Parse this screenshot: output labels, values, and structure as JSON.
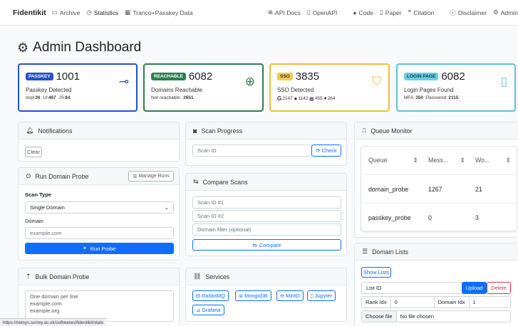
{
  "nav": {
    "brand": "Fidentikit",
    "items": [
      {
        "icon": "archive-icon",
        "glyph": "▭",
        "label": "Archive"
      },
      {
        "icon": "speedometer-icon",
        "glyph": "◷",
        "label": "Statistics"
      },
      {
        "icon": "dataset-icon",
        "glyph": "▦",
        "label": "Tranco+Passkey Data"
      },
      {
        "icon": "globe-icon",
        "glyph": "⊕",
        "label": "API Docs"
      },
      {
        "icon": "file-icon",
        "glyph": "▯",
        "label": "OpenAPI"
      },
      {
        "icon": "github-icon",
        "glyph": "●",
        "label": "Code"
      },
      {
        "icon": "paper-icon",
        "glyph": "▯",
        "label": "Paper"
      },
      {
        "icon": "quote-icon",
        "glyph": "❝",
        "label": "Citation"
      },
      {
        "icon": "info-icon",
        "glyph": "ⓘ",
        "label": "Disclaimer"
      },
      {
        "icon": "gear-icon",
        "glyph": "⚙",
        "label": "Admin"
      }
    ]
  },
  "page": {
    "title": "Admin Dashboard"
  },
  "stats": {
    "passkey": {
      "badge": "PASSKEY",
      "value": "1001",
      "sub": "Passkey Detected",
      "impl_label": "Impl",
      "impl": "26",
      "ui_label": "UI",
      "ui": "467",
      "js_label": "JS",
      "js": "84",
      "color": "#2451c7",
      "badge_color": "#2451c7"
    },
    "reachable": {
      "badge": "REACHABLE",
      "value": "6082",
      "sub": "Domains Reachable",
      "not_label": "Not reachable:",
      "not_value": "2651",
      "color": "#2e7d4f",
      "badge_color": "#2e7d4f"
    },
    "sso": {
      "badge": "SSO",
      "value": "3835",
      "sub": "SSO Detected",
      "google": "2147",
      "apple": "1142",
      "microsoft": "455",
      "github": "264",
      "color": "#f0bf3a",
      "badge_color": "#f2c94c"
    },
    "login": {
      "badge": "LOGIN PAGE",
      "value": "6082",
      "sub": "Login Pages Found",
      "mfa_label": "MFA:",
      "mfa": "350",
      "pw_label": "Password:",
      "pw": "2115",
      "color": "#5bc3df",
      "badge_color": "#66cfe6"
    }
  },
  "notifications": {
    "title": "Notifications",
    "clear": "Clear"
  },
  "scan_progress": {
    "title": "Scan Progress",
    "placeholder": "Scan ID",
    "check": "Check"
  },
  "queue": {
    "title": "Queue Monitor",
    "headers": [
      "Queue",
      "Mess...",
      "Wo..."
    ],
    "rows": [
      {
        "name": "domain_probe",
        "messages": "1267",
        "workers": "21"
      },
      {
        "name": "passkey_probe",
        "messages": "0",
        "workers": "3"
      }
    ]
  },
  "run_probe": {
    "title": "Run Domain Probe",
    "manage": "Manage Runs",
    "scan_type_label": "Scan Type",
    "scan_type": "Single Domain",
    "domain_label": "Domain",
    "domain_placeholder": "example.com",
    "run": "Run Probe"
  },
  "compare": {
    "title": "Compare Scans",
    "id1": "Scan ID #1",
    "id2": "Scan ID #2",
    "filter": "Domain filter (optional)",
    "button": "Compare"
  },
  "domain_lists": {
    "title": "Domain Lists",
    "show": "Show Lists",
    "list_id": "List ID",
    "upload": "Upload",
    "delete": "Delete",
    "rank_label": "Rank Idx",
    "rank_value": "0",
    "dom_label": "Domain Idx",
    "dom_value": "1",
    "choose": "Choose file",
    "no_file": "No file chosen"
  },
  "bulk": {
    "title": "Bulk Domain Probe",
    "line1": "One domain per line",
    "line2": "example.com",
    "line3": "example.org"
  },
  "services": {
    "title": "Services",
    "items": [
      "RabbitMQ",
      "MongoDB",
      "MinIO",
      "Jupyter",
      "Grafana"
    ]
  },
  "status_url": "https://netsys.surrey.ac.uk/softwares/fidentikit/stats"
}
